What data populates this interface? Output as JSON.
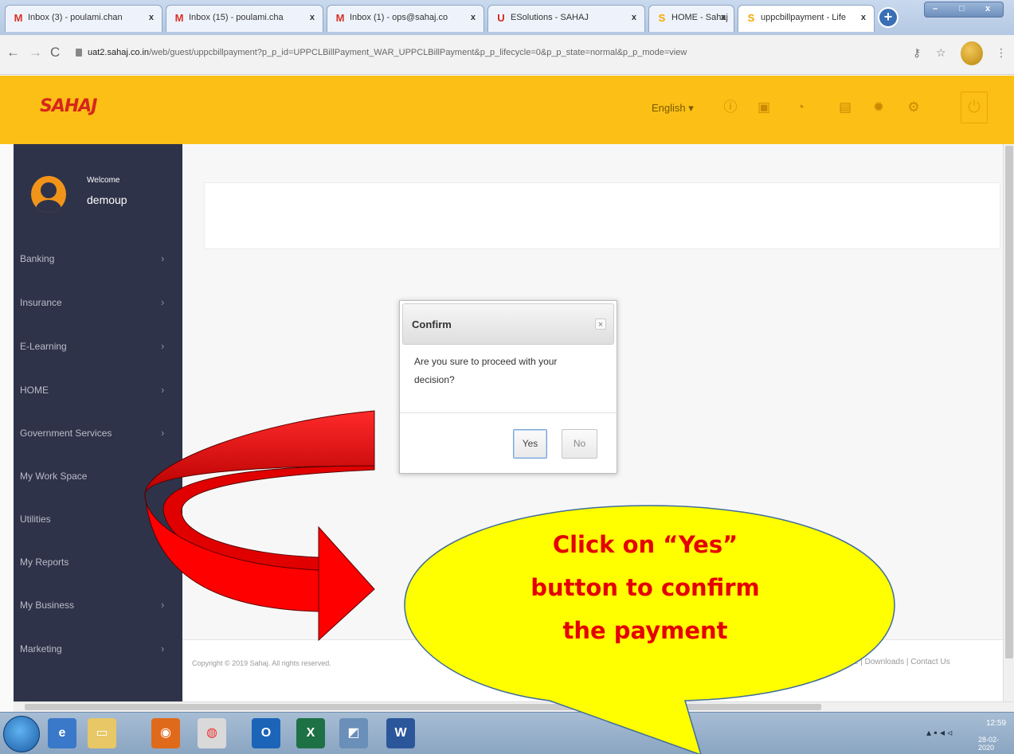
{
  "browser": {
    "tabs": [
      {
        "label": "Inbox (3) - poulami.chan",
        "favicon": "gmail-icon",
        "favicon_color": "#d93025"
      },
      {
        "label": "Inbox (15) - poulami.cha",
        "favicon": "gmail-icon",
        "favicon_color": "#d93025"
      },
      {
        "label": "Inbox (1) - ops@sahaj.co",
        "favicon": "gmail-icon",
        "favicon_color": "#d93025"
      },
      {
        "label": "ESolutions - SAHAJ",
        "favicon": "sahaj-icon",
        "favicon_color": "#d7261b"
      },
      {
        "label": "HOME - Sahaj",
        "favicon": "sahaj-s-icon",
        "favicon_color": "#f7a600"
      },
      {
        "label": "uppcbillpayment - Life",
        "favicon": "sahaj-s-icon",
        "favicon_color": "#f7a600"
      }
    ],
    "tab_close_glyph": "x",
    "url_host": "uat2.sahaj.co.in",
    "url_path": "/web/guest/uppcbillpayment?p_p_id=UPPCLBillPayment_WAR_UPPCLBillPayment&p_p_lifecycle=0&p_p_state=normal&p_p_mode=view"
  },
  "app": {
    "logo": "SAHAJ",
    "language": "English",
    "brand_color": "#fbbf16",
    "sidebar_color": "#2f3349"
  },
  "sidebar": {
    "welcome_label": "Welcome",
    "username": "demoup",
    "items": [
      {
        "label": "Banking",
        "has_submenu": true
      },
      {
        "label": "Insurance",
        "has_submenu": true
      },
      {
        "label": "E-Learning",
        "has_submenu": true
      },
      {
        "label": "HOME",
        "has_submenu": true
      },
      {
        "label": "Government Services",
        "has_submenu": true
      },
      {
        "label": "My Work Space",
        "has_submenu": false
      },
      {
        "label": "Utilities",
        "has_submenu": false
      },
      {
        "label": "My Reports",
        "has_submenu": false
      },
      {
        "label": "My Business",
        "has_submenu": true
      },
      {
        "label": "Marketing",
        "has_submenu": true
      }
    ]
  },
  "dialog": {
    "title": "Confirm",
    "close_glyph": "×",
    "message": "Are you sure to proceed with your decision?",
    "yes_label": "Yes",
    "no_label": "No"
  },
  "footer": {
    "copyright": "Copyright © 2019 Sahaj. All rights reserved.",
    "links": "Corporate | Downloads | Contact Us"
  },
  "annotation": {
    "callout_lines": [
      "Click on “Yes”",
      "button to confirm",
      "the payment"
    ],
    "arrow_color": "#ff0000",
    "callout_fill": "#ffff00"
  },
  "taskbar": {
    "time": "12:59",
    "date": "28-02-2020"
  }
}
